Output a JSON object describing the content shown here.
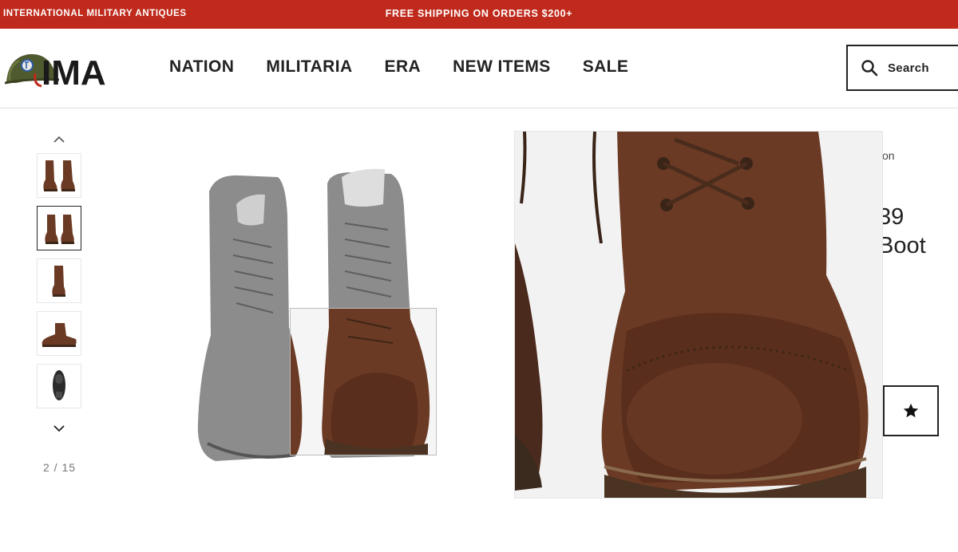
{
  "banner": {
    "left_text": "INTERNATIONAL MILITARY ANTIQUES",
    "center_text": "FREE SHIPPING ON ORDERS $200+"
  },
  "header": {
    "logo_text": "IMA",
    "nav": [
      "NATION",
      "MILITARIA",
      "ERA",
      "NEW ITEMS",
      "SALE"
    ],
    "search_label": "Search"
  },
  "gallery": {
    "counter": "2 / 15",
    "active_index": 2,
    "thumbnails": [
      "boots-front",
      "boots-front-zoom",
      "boot-side",
      "boot-profile",
      "boot-sole"
    ]
  },
  "product_partial": {
    "crumb_fragment": "tion",
    "title_line1_fragment": "39",
    "title_line2_fragment": "Boot"
  },
  "colors": {
    "brand_red": "#bf2a1c",
    "text_dark": "#222222",
    "leather_brown": "#6b3a24"
  },
  "icons": {
    "search": "magnifier-icon",
    "wishlist": "star-icon",
    "up": "chevron-up-icon",
    "down": "chevron-down-icon"
  }
}
